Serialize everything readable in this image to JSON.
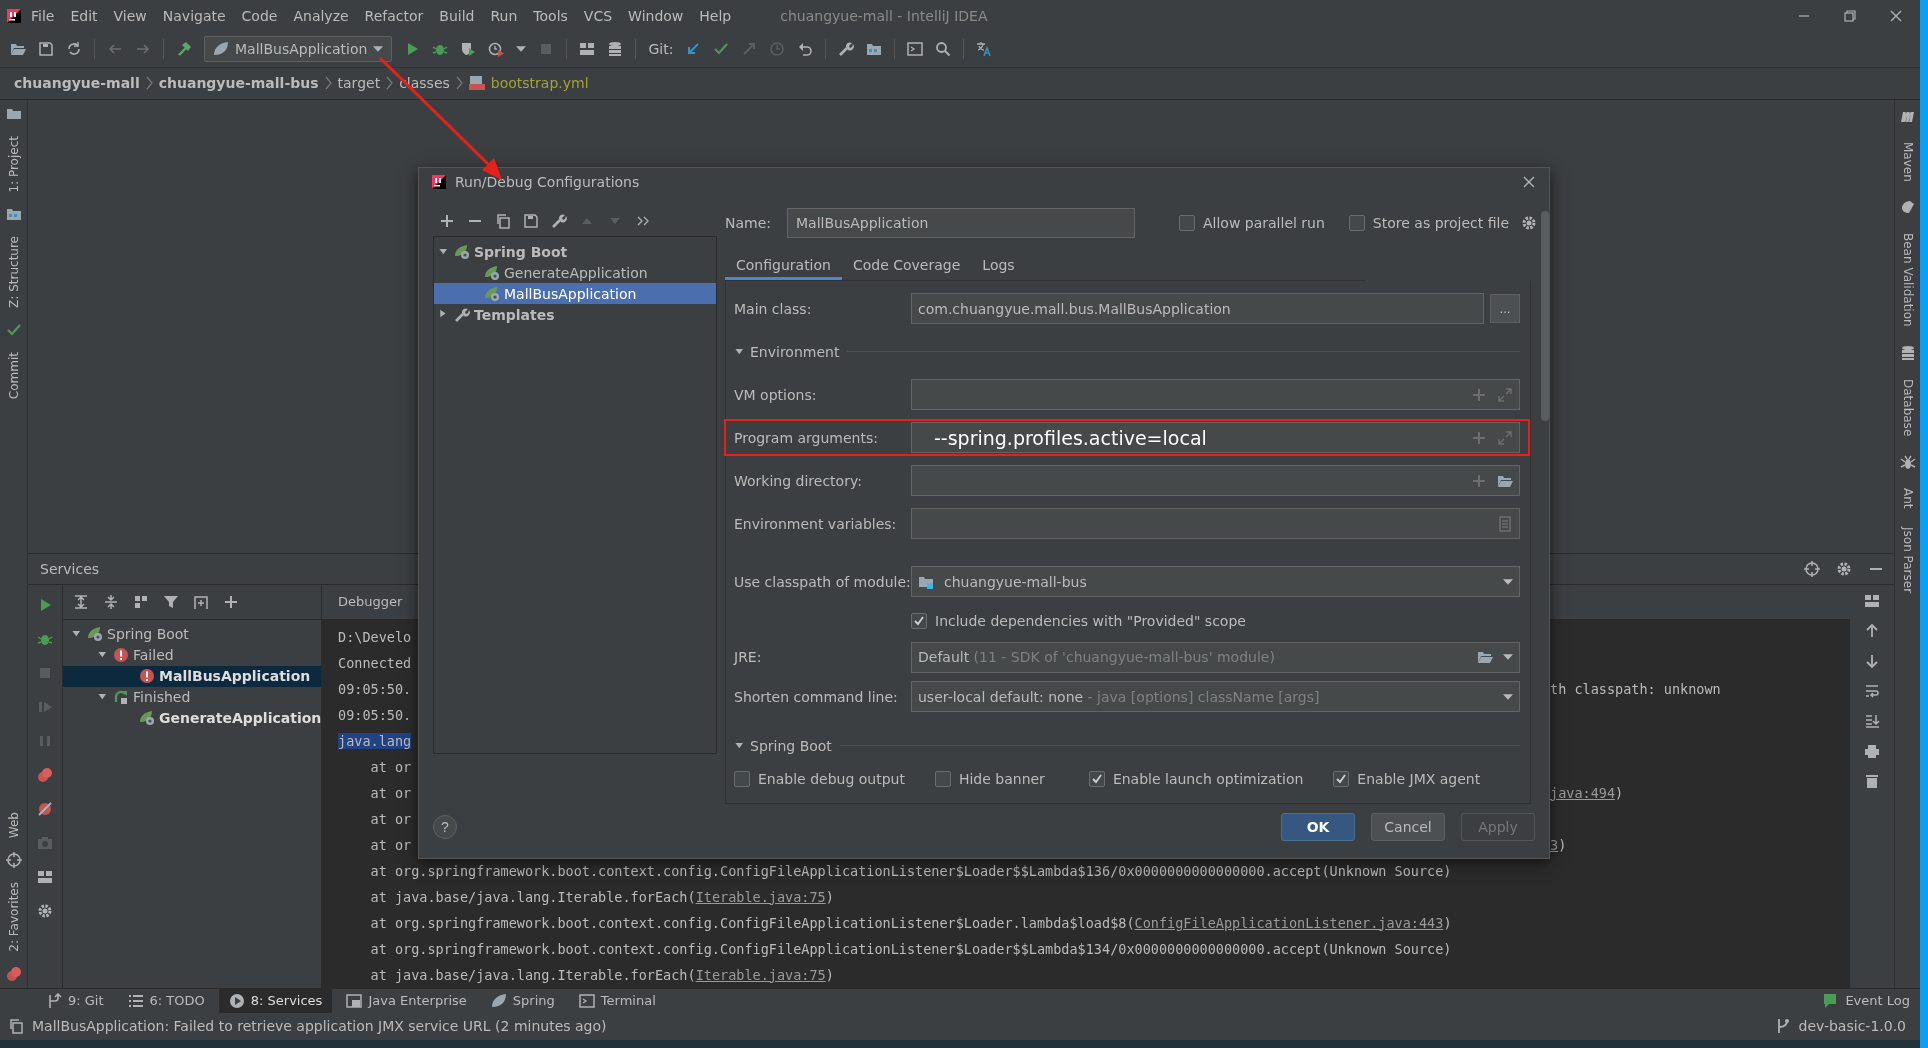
{
  "window": {
    "title": "chuangyue-mall - IntelliJ IDEA"
  },
  "menu": [
    "File",
    "Edit",
    "View",
    "Navigate",
    "Code",
    "Analyze",
    "Refactor",
    "Build",
    "Run",
    "Tools",
    "VCS",
    "Window",
    "Help"
  ],
  "toolbar": {
    "run_configuration": "MallBusApplication",
    "git_label": "Git:"
  },
  "breadcrumbs": [
    {
      "label": "chuangyue-mall",
      "kind": "project"
    },
    {
      "label": "chuangyue-mall-bus",
      "kind": "project"
    },
    {
      "label": "target",
      "kind": "folder"
    },
    {
      "label": "classes",
      "kind": "folder"
    },
    {
      "label": "bootstrap.yml",
      "kind": "file"
    }
  ],
  "left_tool_windows": {
    "top": [
      "1: Project",
      "Z: Structure",
      "Commit"
    ],
    "bottom": [
      "Web",
      "2: Favorites"
    ]
  },
  "right_tool_windows": [
    "Maven",
    "Bean Validation",
    "Database",
    "Ant",
    "Json Parser"
  ],
  "services": {
    "title": "Services",
    "console_tab": "Debugger",
    "tree": [
      {
        "label": "Spring Boot",
        "kind": "spring",
        "expanded": true,
        "selected": false,
        "children": [
          {
            "label": "Failed",
            "kind": "failed",
            "expanded": true,
            "selected": false,
            "children": [
              {
                "label": "MallBusApplication",
                "kind": "failed",
                "selected": true
              }
            ]
          },
          {
            "label": "Finished",
            "kind": "finished",
            "expanded": true,
            "selected": false,
            "children": [
              {
                "label": "GenerateApplication",
                "kind": "spring",
                "selected": false
              }
            ]
          }
        ]
      }
    ],
    "console_lines": [
      {
        "kind": "split",
        "highlighted": false,
        "left": "D:\\Develo"
      },
      {
        "kind": "split",
        "highlighted": false,
        "left": "Connected"
      },
      {
        "kind": "split",
        "highlighted": false,
        "left": "09:05:50.",
        "right": [
          {
            "text": "th classpath: unknown",
            "link": false
          }
        ]
      },
      {
        "kind": "split",
        "highlighted": false,
        "left": "09:05:50."
      },
      {
        "kind": "split",
        "highlighted": true,
        "left": "java.lang"
      },
      {
        "kind": "split",
        "highlighted": false,
        "left": "    at or"
      },
      {
        "kind": "split",
        "highlighted": false,
        "left": "    at or",
        "right": [
          {
            "text": "java:494",
            "link": true
          },
          {
            "text": ")",
            "link": false
          }
        ]
      },
      {
        "kind": "split",
        "highlighted": false,
        "left": "    at or"
      },
      {
        "kind": "split",
        "highlighted": false,
        "left": "    at or",
        "right": [
          {
            "text": "3",
            "link": true
          },
          {
            "text": ")",
            "link": false
          }
        ]
      },
      {
        "kind": "full",
        "highlighted": false,
        "parts": [
          {
            "text": "    at org.springframework.boot.context.config.ConfigFileApplicationListener$Loader$$Lambda$136/0x0000000000000000.accept(Unknown Source)",
            "link": false
          }
        ]
      },
      {
        "kind": "full",
        "highlighted": false,
        "parts": [
          {
            "text": "    at java.base/java.lang.Iterable.forEach(",
            "link": false
          },
          {
            "text": "Iterable.java:75",
            "link": true
          },
          {
            "text": ")",
            "link": false
          }
        ]
      },
      {
        "kind": "full",
        "highlighted": false,
        "parts": [
          {
            "text": "    at org.springframework.boot.context.config.ConfigFileApplicationListener$Loader.lambda$load$8(",
            "link": false
          },
          {
            "text": "ConfigFileApplicationListener.java:443",
            "link": true
          },
          {
            "text": ")",
            "link": false
          }
        ]
      },
      {
        "kind": "full",
        "highlighted": false,
        "parts": [
          {
            "text": "    at org.springframework.boot.context.config.ConfigFileApplicationListener$Loader$$Lambda$134/0x0000000000000000.accept(Unknown Source)",
            "link": false
          }
        ]
      },
      {
        "kind": "full",
        "highlighted": false,
        "parts": [
          {
            "text": "    at java.base/java.lang.Iterable.forEach(",
            "link": false
          },
          {
            "text": "Iterable.java:75",
            "link": true
          },
          {
            "text": ")",
            "link": false
          }
        ]
      }
    ]
  },
  "dialog": {
    "title": "Run/Debug Configurations",
    "tree": [
      {
        "label": "Spring Boot",
        "kind": "group",
        "expanded": true,
        "selected": false,
        "children": [
          {
            "label": "GenerateApplication",
            "kind": "app",
            "selected": false
          },
          {
            "label": "MallBusApplication",
            "kind": "app",
            "selected": true
          }
        ]
      },
      {
        "label": "Templates",
        "kind": "templates",
        "expanded": false,
        "selected": false
      }
    ],
    "name_label": "Name:",
    "name_value": "MallBusApplication",
    "options": [
      {
        "label": "Allow parallel run",
        "checked": false
      },
      {
        "label": "Store as project file",
        "checked": false
      }
    ],
    "tabs": [
      {
        "label": "Configuration",
        "selected": true
      },
      {
        "label": "Code Coverage",
        "selected": false
      },
      {
        "label": "Logs",
        "selected": false
      }
    ],
    "form": [
      {
        "kind": "class_field",
        "label": "Main class:",
        "value": "com.chuangyue.mall.bus.MallBusApplication",
        "button": "..."
      },
      {
        "kind": "section",
        "label": "Environment",
        "expanded": true
      },
      {
        "kind": "args_field",
        "label": "VM options:",
        "highlighted": false
      },
      {
        "kind": "args_field",
        "label": "Program arguments:",
        "value": "--spring.profiles.active=local",
        "highlighted": true
      },
      {
        "kind": "dir_field",
        "label": "Working directory:"
      },
      {
        "kind": "env_field",
        "label": "Environment variables:"
      },
      {
        "kind": "module_dropdown",
        "label": "Use classpath of module:",
        "value": "chuangyue-mall-bus"
      },
      {
        "kind": "checkbox",
        "label": "Include dependencies with \"Provided\" scope",
        "checked": true
      },
      {
        "kind": "jre_dropdown",
        "label": "JRE:",
        "value": "Default",
        "hint": "(11 - SDK of 'chuangyue-mall-bus' module)"
      },
      {
        "kind": "dropdown",
        "label": "Shorten command line:",
        "value": "user-local default: none",
        "hint": "- java [options] className [args]"
      },
      {
        "kind": "section",
        "label": "Spring Boot",
        "expanded": true
      },
      {
        "kind": "checkbox_row",
        "items": [
          {
            "label": "Enable debug output",
            "checked": false
          },
          {
            "label": "Hide banner",
            "checked": false
          },
          {
            "label": "Enable launch optimization",
            "checked": true
          },
          {
            "label": "Enable JMX agent",
            "checked": true
          }
        ]
      }
    ],
    "help": "?",
    "buttons": [
      {
        "label": "OK",
        "kind": "default",
        "disabled": false
      },
      {
        "label": "Cancel",
        "kind": "plain",
        "disabled": false
      },
      {
        "label": "Apply",
        "kind": "plain",
        "disabled": true
      }
    ]
  },
  "tool_tabs": [
    {
      "label": "9: Git",
      "kind": "git",
      "selected": false
    },
    {
      "label": "6: TODO",
      "kind": "todo",
      "selected": false
    },
    {
      "label": "8: Services",
      "kind": "services",
      "selected": true
    },
    {
      "label": "Java Enterprise",
      "kind": "enterprise",
      "selected": false
    },
    {
      "label": "Spring",
      "kind": "spring",
      "selected": false
    },
    {
      "label": "Terminal",
      "kind": "terminal",
      "selected": false
    }
  ],
  "event_log": "Event Log",
  "status_bar": {
    "message": "MallBusApplication: Failed to retrieve application JMX service URL (2 minutes ago)",
    "branch": "dev-basic-1.0.0"
  }
}
